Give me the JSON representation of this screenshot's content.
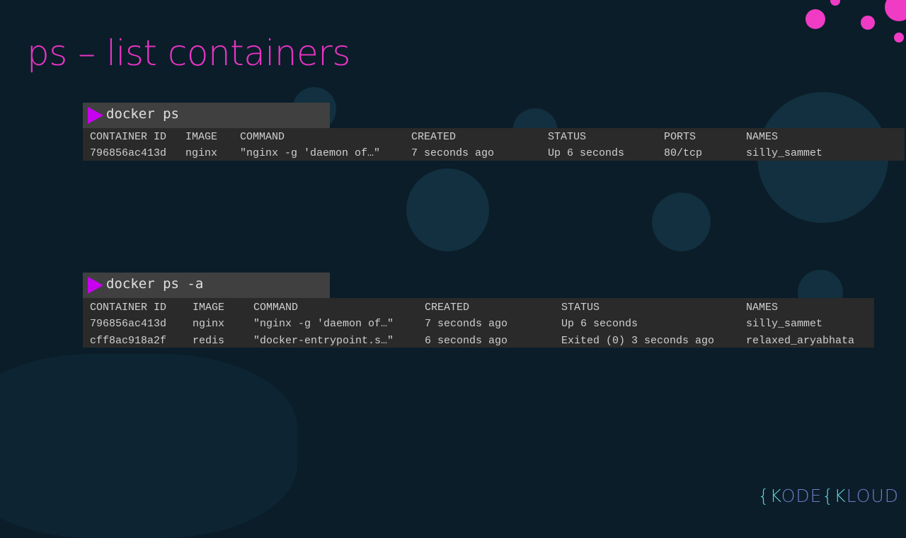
{
  "title": "ps – list containers",
  "colors": {
    "accent": "#e934c4",
    "prompt_icon": "#c800f0",
    "background": "#0a1d29"
  },
  "logo": {
    "text": "KODEKLOUD"
  },
  "block1": {
    "command": "docker ps",
    "headers": [
      "CONTAINER ID",
      "IMAGE",
      "COMMAND",
      "CREATED",
      "STATUS",
      "PORTS",
      "NAMES"
    ],
    "rows": [
      [
        "796856ac413d",
        "nginx",
        "\"nginx -g 'daemon of…\"",
        "7 seconds ago",
        "Up 6 seconds",
        "80/tcp",
        "silly_sammet"
      ]
    ]
  },
  "block2": {
    "command": "docker ps -a",
    "headers": [
      "CONTAINER ID",
      "IMAGE",
      "COMMAND",
      "CREATED",
      "STATUS",
      "NAMES"
    ],
    "rows": [
      [
        "796856ac413d",
        "nginx",
        "\"nginx -g 'daemon of…\"",
        "7 seconds ago",
        "Up 6 seconds",
        "silly_sammet"
      ],
      [
        "cff8ac918a2f",
        "redis",
        "\"docker-entrypoint.s…\"",
        "6 seconds ago",
        "Exited (0) 3 seconds ago",
        "relaxed_aryabhata"
      ]
    ]
  }
}
